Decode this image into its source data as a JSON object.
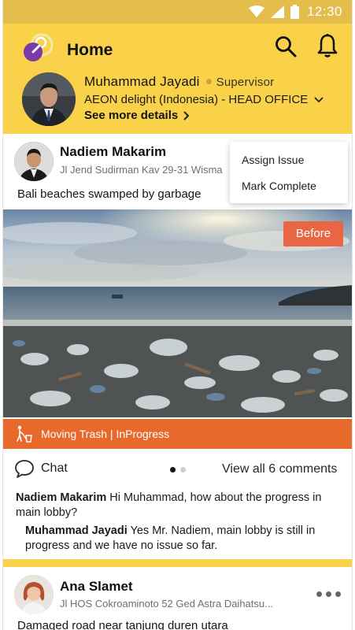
{
  "status_bar": {
    "time": "12:30"
  },
  "header": {
    "title": "Home",
    "user": {
      "name": "Muhammad Jayadi",
      "role": "Supervisor",
      "company": "AEON delight (Indonesia) - HEAD OFFICE",
      "see_more": "See more details"
    }
  },
  "posts": [
    {
      "author": "Nadiem Makarim",
      "address": "Jl Jend Sudirman Kav 29-31 Wisma",
      "title": "Bali beaches swamped by garbage",
      "menu": [
        "Assign Issue",
        "Mark Complete"
      ],
      "photo_badge": "Before",
      "status": "Moving Trash | InProgress",
      "chat_label": "Chat",
      "view_comments": "View all 6 comments",
      "comments": [
        {
          "author": "Nadiem Makarim",
          "text": "Hi Muhammad, how about the progress in main lobby?"
        },
        {
          "author": "Muhammad Jayadi",
          "text": "Yes Mr. Nadiem, main lobby is still in progress and we have no issue so far."
        }
      ]
    },
    {
      "author": "Ana Slamet",
      "address": "Jl HOS Cokroaminoto 52 Ged Astra Daihatsu...",
      "title": "Damaged road near tanjung duren utara"
    }
  ],
  "colors": {
    "header_yellow": "#fad24a",
    "status_bar": "#e5bd4d",
    "status_strip": "#e8692c",
    "before_badge": "#e86644",
    "logo_purple": "#7a3aa8"
  },
  "icons": [
    "app-logo-icon",
    "search-icon",
    "bell-icon",
    "chevron-down-icon",
    "chevron-right-icon",
    "trash-cleaner-icon",
    "chat-bubble-icon",
    "more-dots-icon"
  ]
}
